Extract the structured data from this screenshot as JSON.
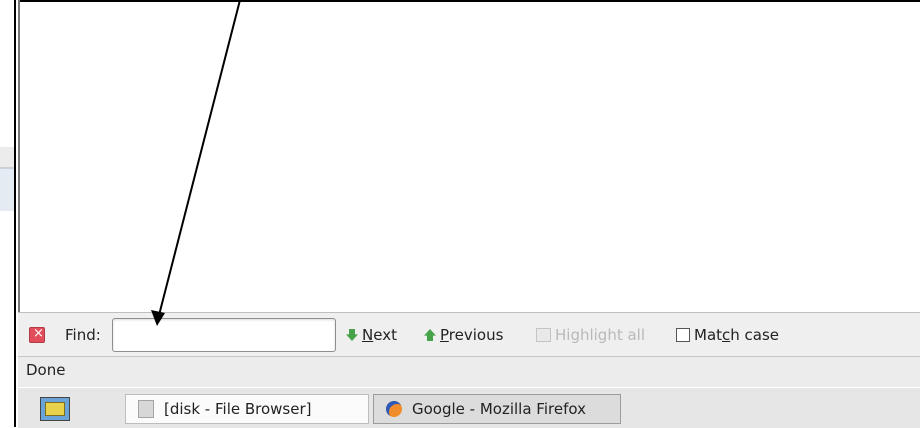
{
  "find_bar": {
    "label": "Find:",
    "input_value": "",
    "next_label_prefix": "",
    "next_label_underlined": "N",
    "next_label_rest": "ext",
    "previous_label_underlined": "P",
    "previous_label_rest": "revious",
    "highlight_label": "Highlight all",
    "match_case_label_pre": "Mat",
    "match_case_label_underlined": "c",
    "match_case_label_post": "h case",
    "match_case_checked": false
  },
  "status_bar": {
    "text": "Done"
  },
  "taskbar": {
    "tasks": [
      {
        "label": "[disk - File Browser]",
        "icon": "file-browser-icon"
      },
      {
        "label": "Google - Mozilla Firefox",
        "icon": "firefox-icon"
      }
    ]
  },
  "annotation": {
    "type": "arrow",
    "color": "#000000"
  },
  "colors": {
    "findbar_bg": "#efefef",
    "statusbar_bg": "#ececec",
    "taskbar_bg": "#e6e6e6",
    "accent_green": "#46a34a"
  }
}
